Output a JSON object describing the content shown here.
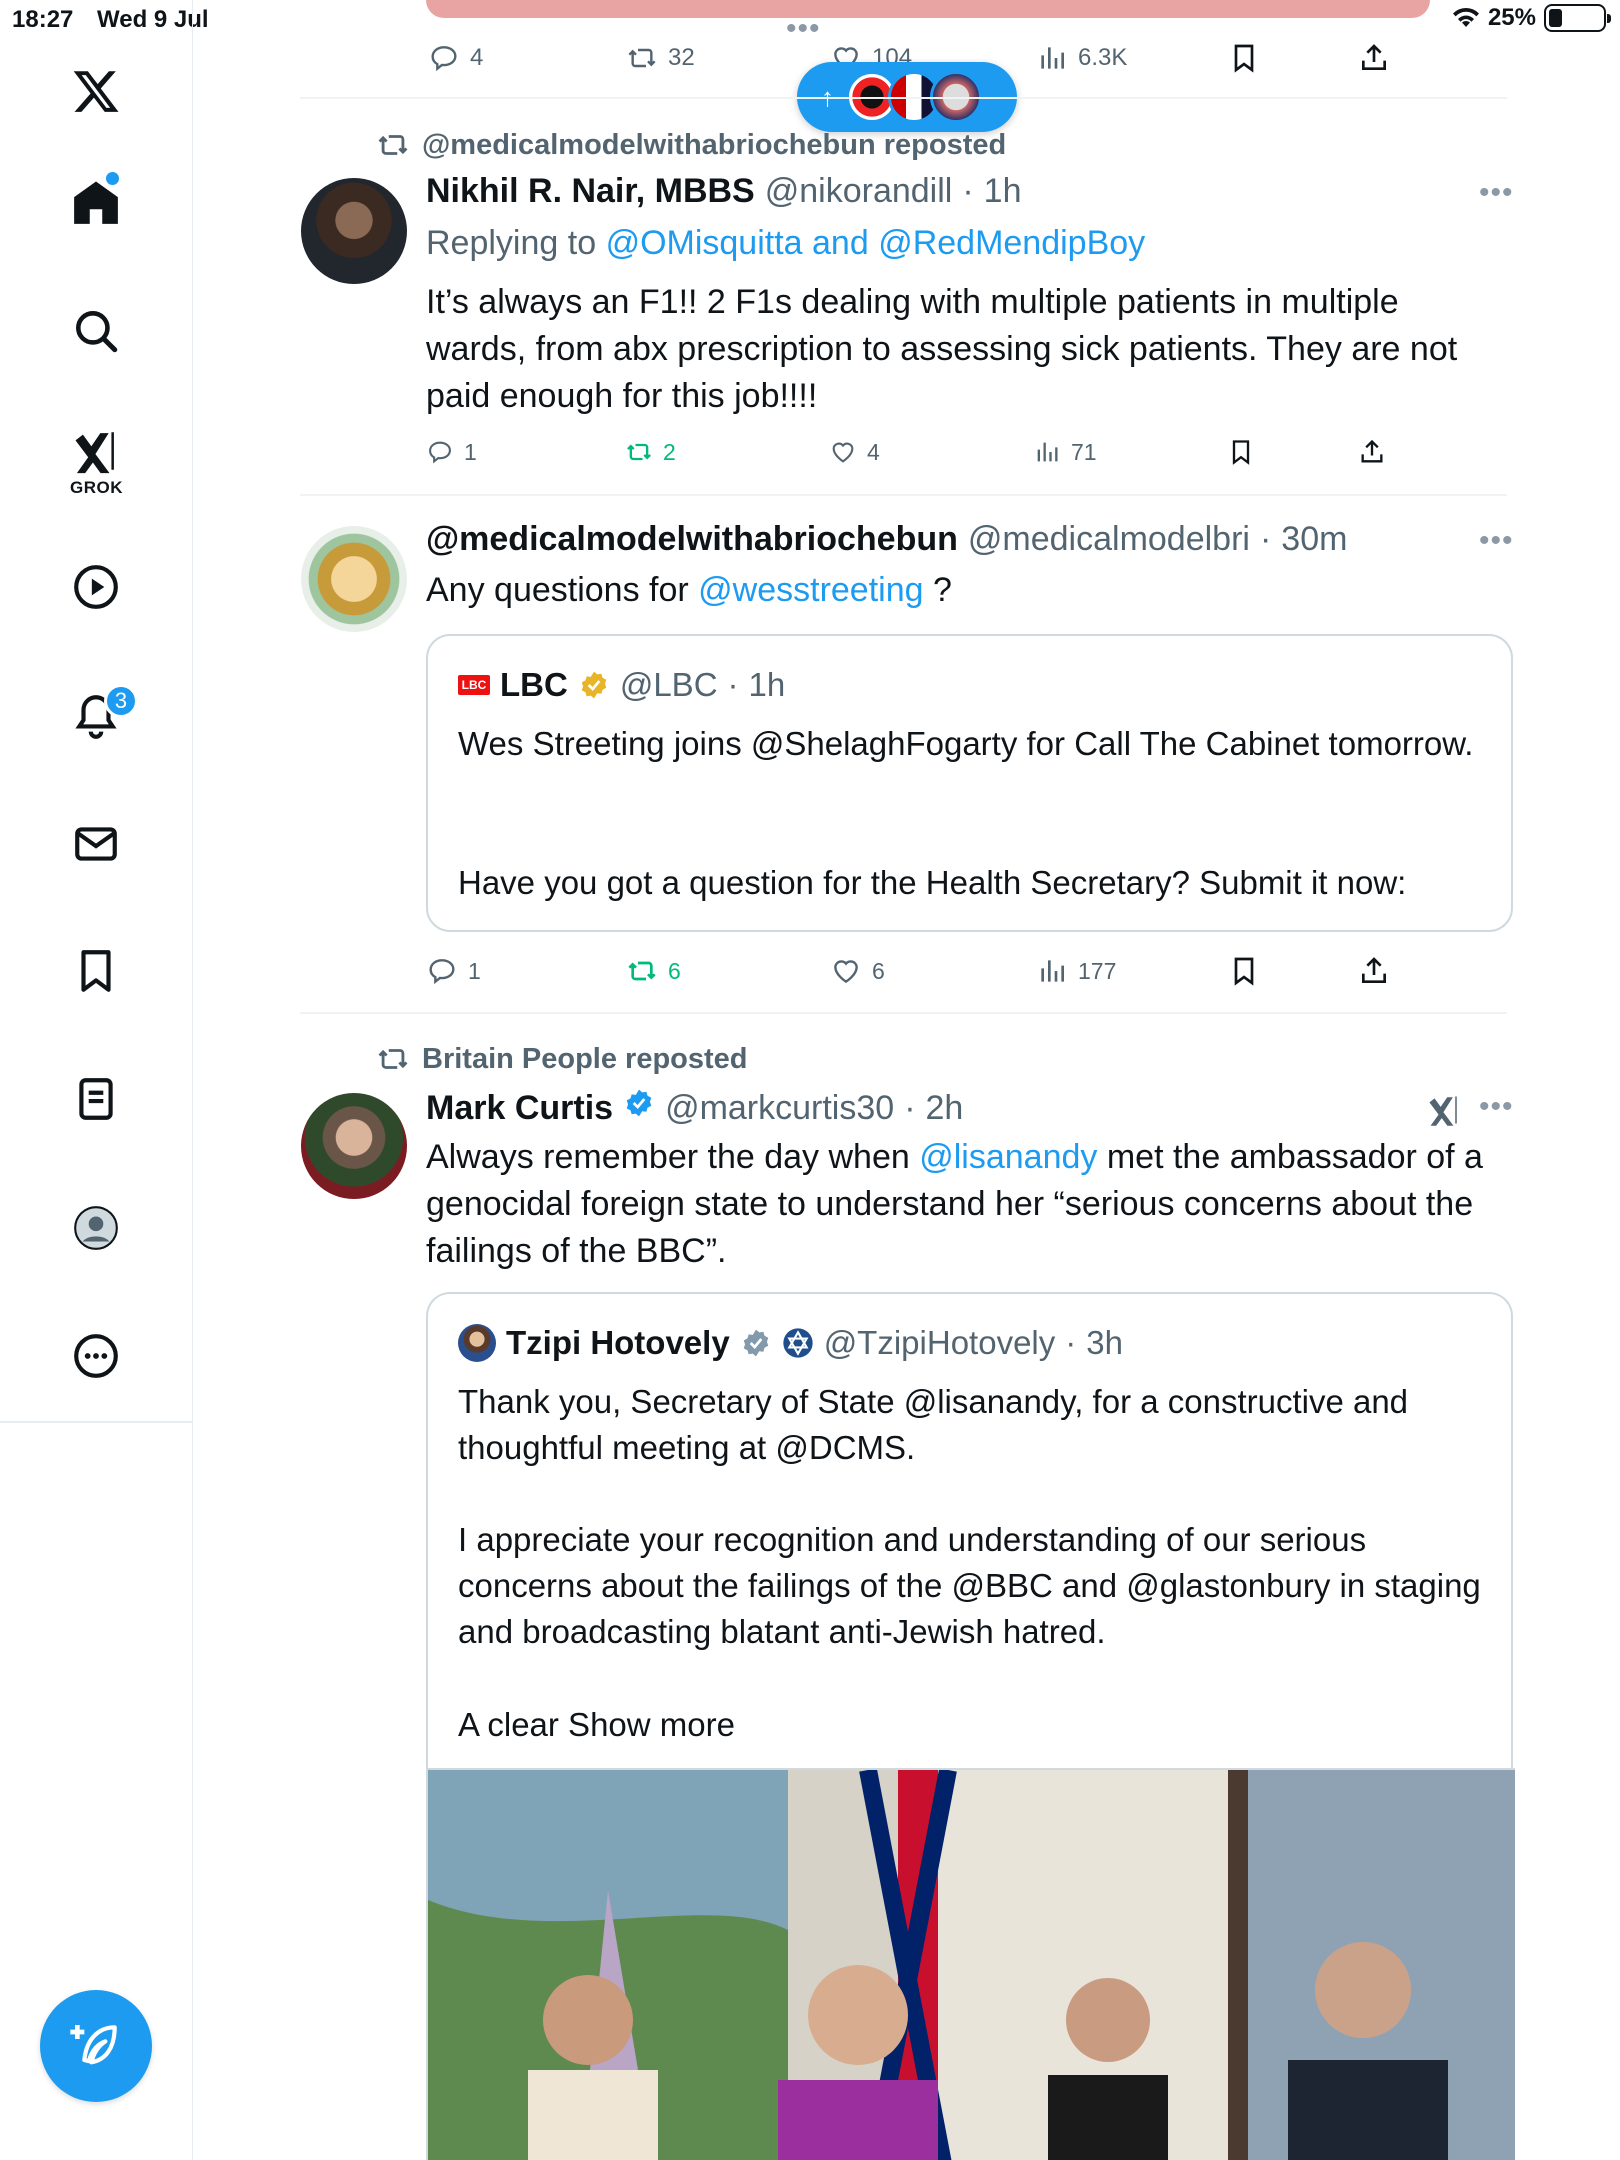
{
  "status_bar": {
    "time": "18:27",
    "date": "Wed 9 Jul",
    "battery": "25%",
    "battery_level": 0.25
  },
  "sidebar": {
    "items": [
      {
        "name": "home",
        "label": "Home"
      },
      {
        "name": "search",
        "label": "Search"
      },
      {
        "name": "grok",
        "label": "GROK"
      },
      {
        "name": "video",
        "label": "Video"
      },
      {
        "name": "notifications",
        "label": "Notifications",
        "badge": "3"
      },
      {
        "name": "messages",
        "label": "Messages"
      },
      {
        "name": "bookmarks",
        "label": "Bookmarks"
      },
      {
        "name": "lists",
        "label": "Lists"
      },
      {
        "name": "profile",
        "label": "Profile"
      },
      {
        "name": "more",
        "label": "More"
      }
    ],
    "grok_label": "GROK",
    "notifications_badge": "3"
  },
  "top_post": {
    "actions": {
      "replies": "4",
      "reposts": "32",
      "likes": "104",
      "views": "6.3K"
    }
  },
  "posts": [
    {
      "repost_by": "@medicalmodelwithabriochebun reposted",
      "name": "Nikhil R. Nair, MBBS",
      "handle": "@nikorandill",
      "time": "1h",
      "replying_to_prefix": "Replying to",
      "replying_to": "@OMisquitta and @RedMendipBoy",
      "text": "It’s always an F1!! 2 F1s dealing with multiple patients in multiple wards, from  abx prescription to assessing sick patients. They are not paid enough for this job!!!!",
      "actions": {
        "replies": "1",
        "reposts": "2",
        "likes": "4",
        "views": "71"
      }
    },
    {
      "name": "@medicalmodelwithabriochebun",
      "handle": "@medicalmodelbri",
      "time": "30m",
      "text_prefix": "Any questions for",
      "text_link": "@wesstreeting",
      "text_suffix": "?",
      "quote": {
        "name": "LBC",
        "handle": "@LBC",
        "time": "1h",
        "text_1": "Wes Streeting joins @ShelaghFogarty for Call The Cabinet tomorrow.",
        "text_2": "Have you got a question for the Health Secretary? Submit it now:"
      },
      "actions": {
        "replies": "1",
        "reposts": "6",
        "likes": "6",
        "views": "177"
      }
    },
    {
      "repost_by": "Britain People reposted",
      "name": "Mark Curtis",
      "handle": "@markcurtis30",
      "time": "2h",
      "text_prefix": "Always remember the day when",
      "text_link": "@lisanandy",
      "text_suffix": "met the ambassador of a genocidal foreign state to understand her “serious concerns about the failings of the BBC”.",
      "quote": {
        "name": "Tzipi Hotovely",
        "handle": "@TzipiHotovely",
        "time": "3h",
        "text_1": "Thank you, Secretary of State @lisanandy, for a constructive and thoughtful meeting at @DCMS.",
        "text_2": "I appreciate your recognition and understanding of our serious concerns about the failings of the @BBC and @glastonbury in staging and broadcasting blatant anti-Jewish hatred.",
        "text_3": "A clear Show more"
      }
    }
  ],
  "dot_sep": "·",
  "colors": {
    "accent": "#1d9bf0",
    "repost_green": "#00ba7c",
    "muted": "#536471"
  }
}
